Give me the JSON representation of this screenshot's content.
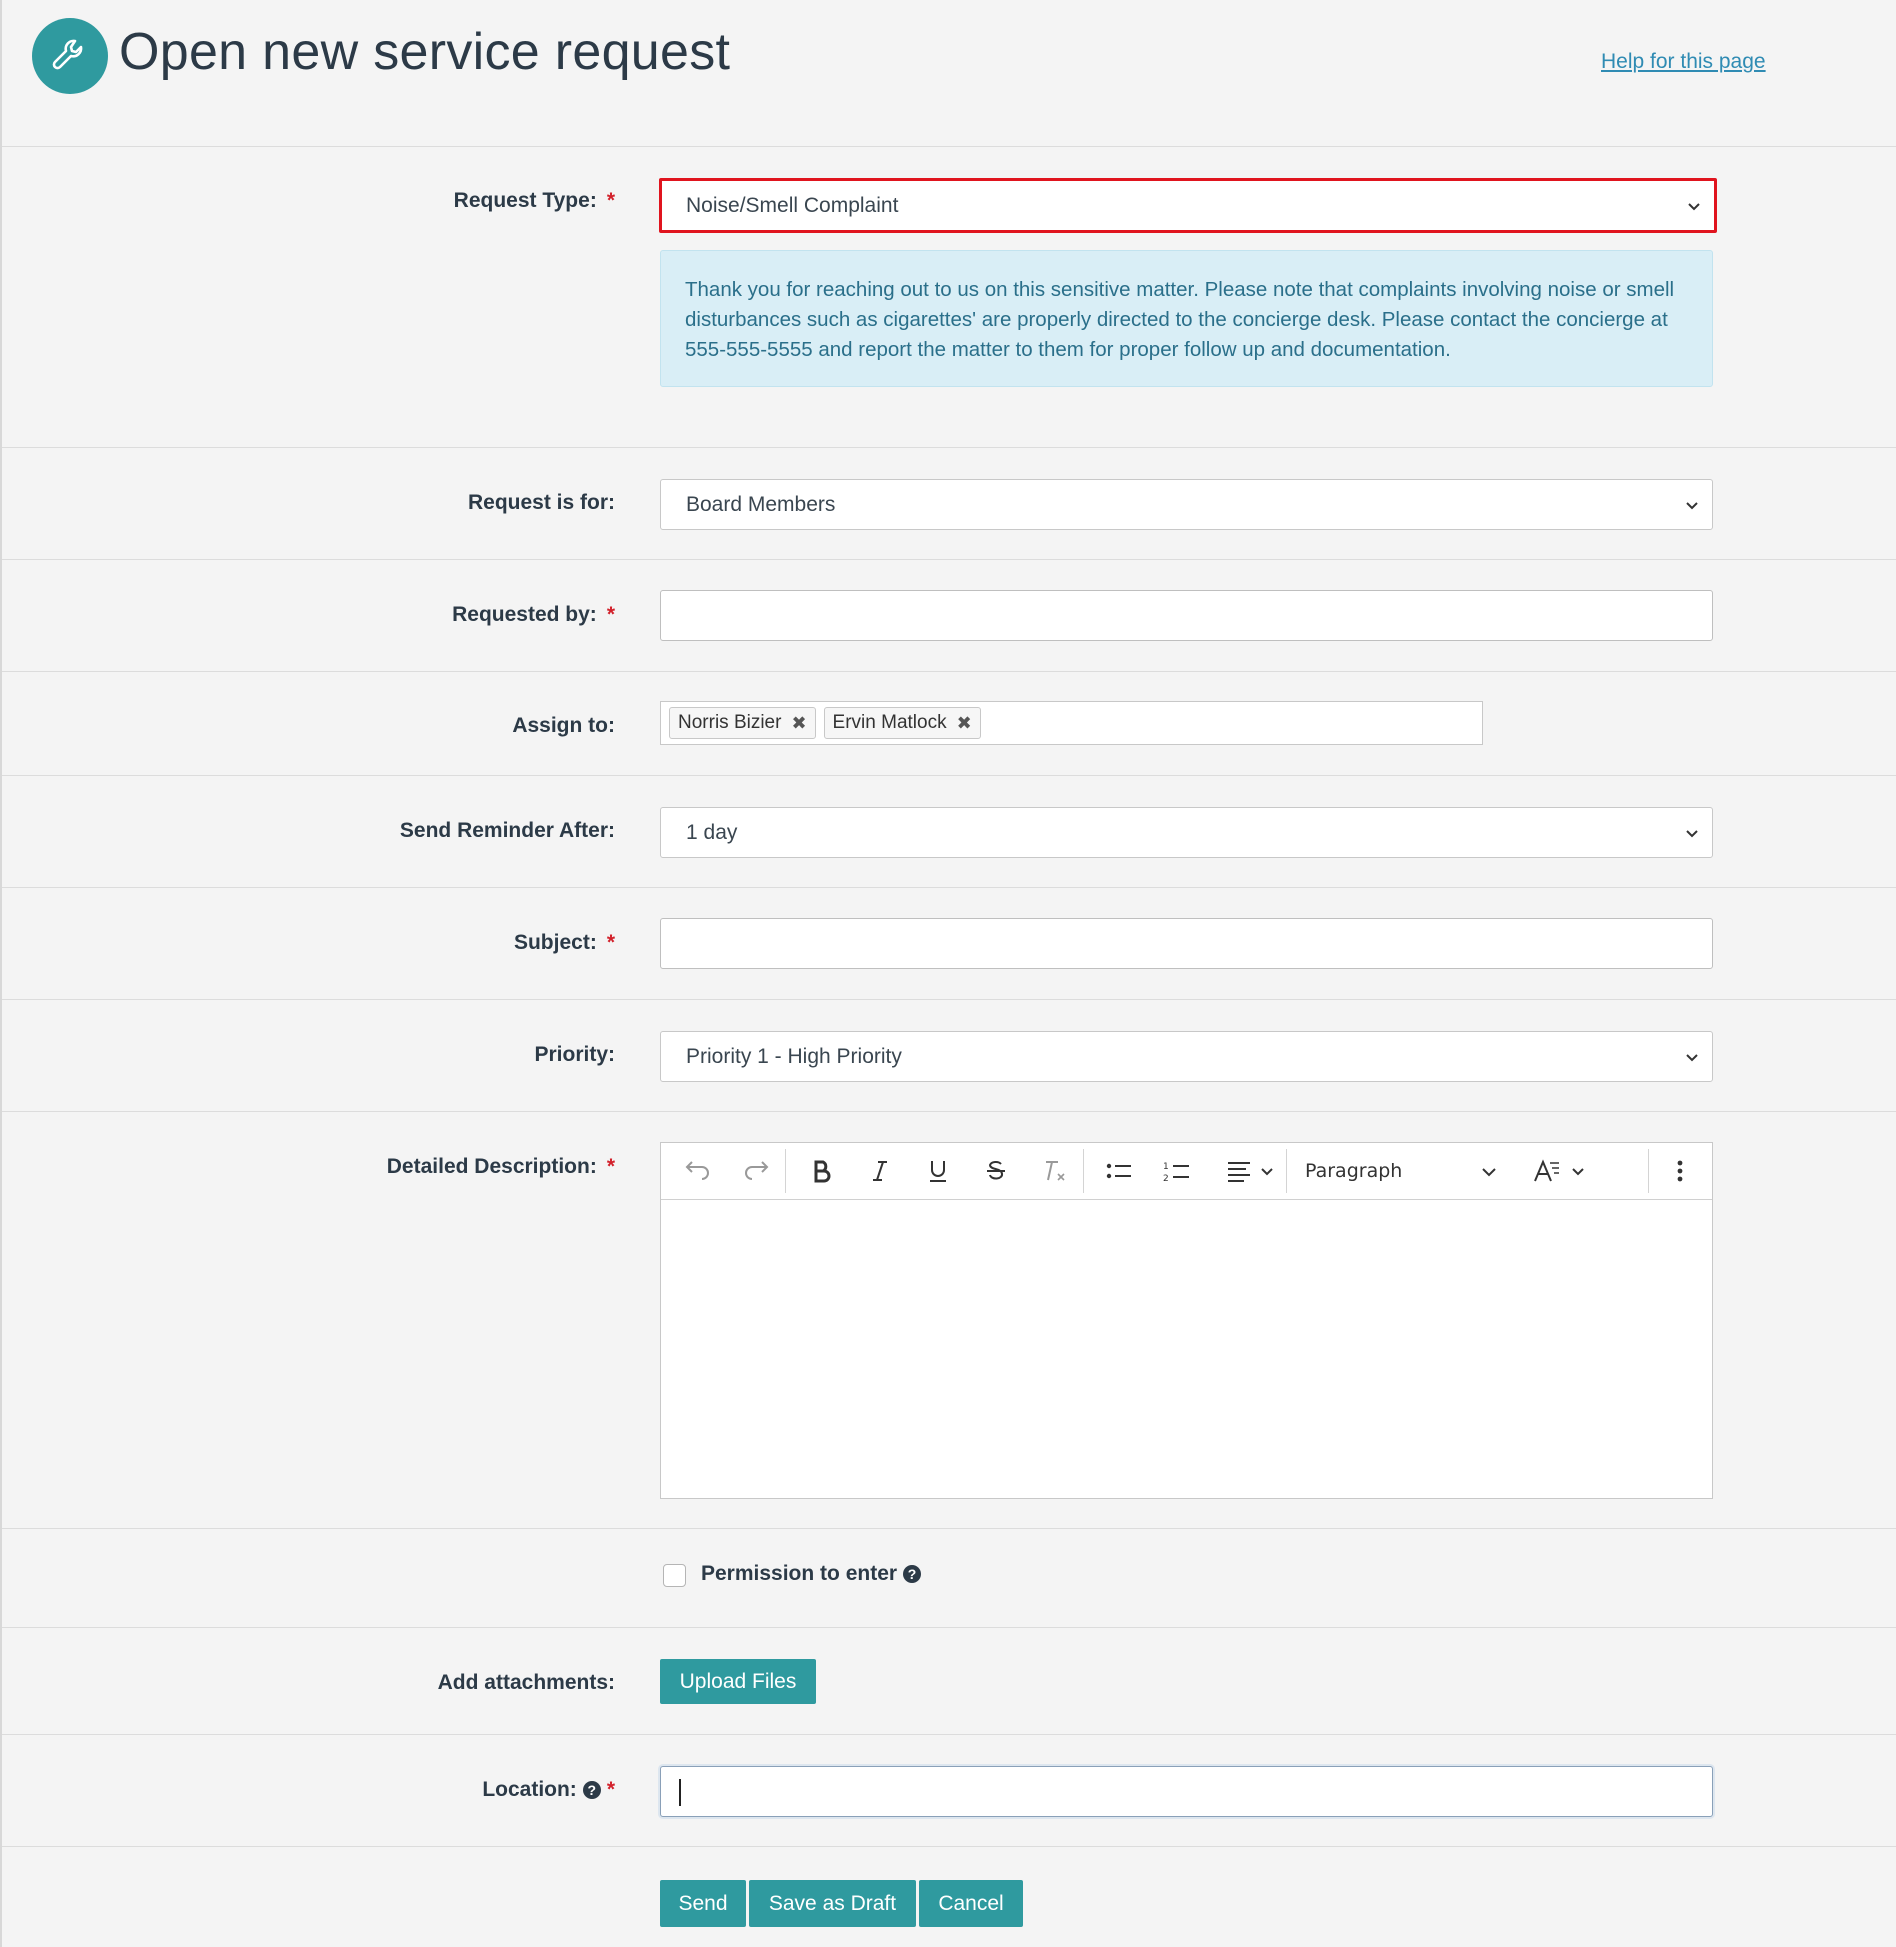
{
  "header": {
    "title": "Open new service request",
    "help_link": "Help for this page",
    "icon": "wrench-icon"
  },
  "form": {
    "request_type": {
      "label": "Request Type:",
      "required": true,
      "value": "Noise/Smell Complaint",
      "state": "error"
    },
    "info_message": "Thank you for reaching out to us on this sensitive matter. Please note that complaints involving noise or smell disturbances such as cigarettes' are properly directed to the concierge desk. Please contact the concierge at 555-555-5555 and report the matter to them for proper follow up and documentation.",
    "request_for": {
      "label": "Request is for:",
      "value": "Board Members"
    },
    "requested_by": {
      "label": "Requested by:",
      "required": true,
      "value": ""
    },
    "assign_to": {
      "label": "Assign to:",
      "tags": [
        "Norris Bizier",
        "Ervin Matlock"
      ]
    },
    "reminder": {
      "label": "Send Reminder After:",
      "value": "1 day"
    },
    "subject": {
      "label": "Subject:",
      "required": true,
      "value": ""
    },
    "priority": {
      "label": "Priority:",
      "value": "Priority 1 - High Priority"
    },
    "description": {
      "label": "Detailed Description:",
      "required": true,
      "paragraph_style": "Paragraph",
      "value": ""
    },
    "permission": {
      "label": "Permission to enter",
      "checked": false
    },
    "attachments": {
      "label": "Add attachments:",
      "button": "Upload Files"
    },
    "location": {
      "label": "Location:",
      "required": true,
      "value": ""
    },
    "required_marker": "*",
    "help_marker": "?"
  },
  "actions": {
    "send": "Send",
    "save_draft": "Save as Draft",
    "cancel": "Cancel"
  },
  "colors": {
    "accent": "#2f9a9f",
    "error": "#e0141e",
    "info_bg": "#d9eef6",
    "info_text": "#2a6f8a",
    "link": "#2f8bb3"
  }
}
